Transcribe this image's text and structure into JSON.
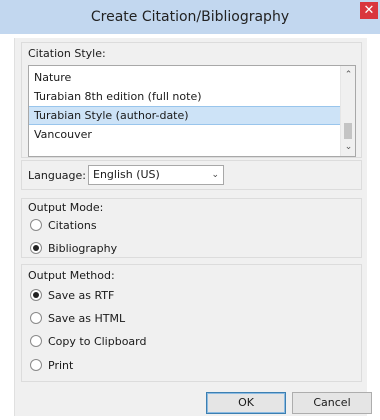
{
  "window": {
    "title": "Create Citation/Bibliography",
    "close_glyph": "✕"
  },
  "citation_style": {
    "label": "Citation Style:",
    "items": [
      {
        "label": "Nature"
      },
      {
        "label": "Turabian 8th edition (full note)"
      },
      {
        "label": "Turabian Style (author-date)",
        "selected": true
      },
      {
        "label": "Vancouver"
      }
    ],
    "scroll_up": "⌃",
    "scroll_down": "⌄"
  },
  "language": {
    "label": "Language:",
    "value": "English (US)",
    "chevron": "⌄"
  },
  "output_mode": {
    "label": "Output Mode:",
    "options": [
      {
        "label": "Citations",
        "checked": false
      },
      {
        "label": "Bibliography",
        "checked": true
      }
    ]
  },
  "output_method": {
    "label": "Output Method:",
    "options": [
      {
        "label": "Save as RTF",
        "checked": true
      },
      {
        "label": "Save as HTML",
        "checked": false
      },
      {
        "label": "Copy to Clipboard",
        "checked": false
      },
      {
        "label": "Print",
        "checked": false
      }
    ]
  },
  "buttons": {
    "ok": "OK",
    "cancel": "Cancel"
  },
  "colors": {
    "titlebar": "#c2d7ef",
    "close": "#d9363e",
    "selection": "#cde3f7"
  }
}
